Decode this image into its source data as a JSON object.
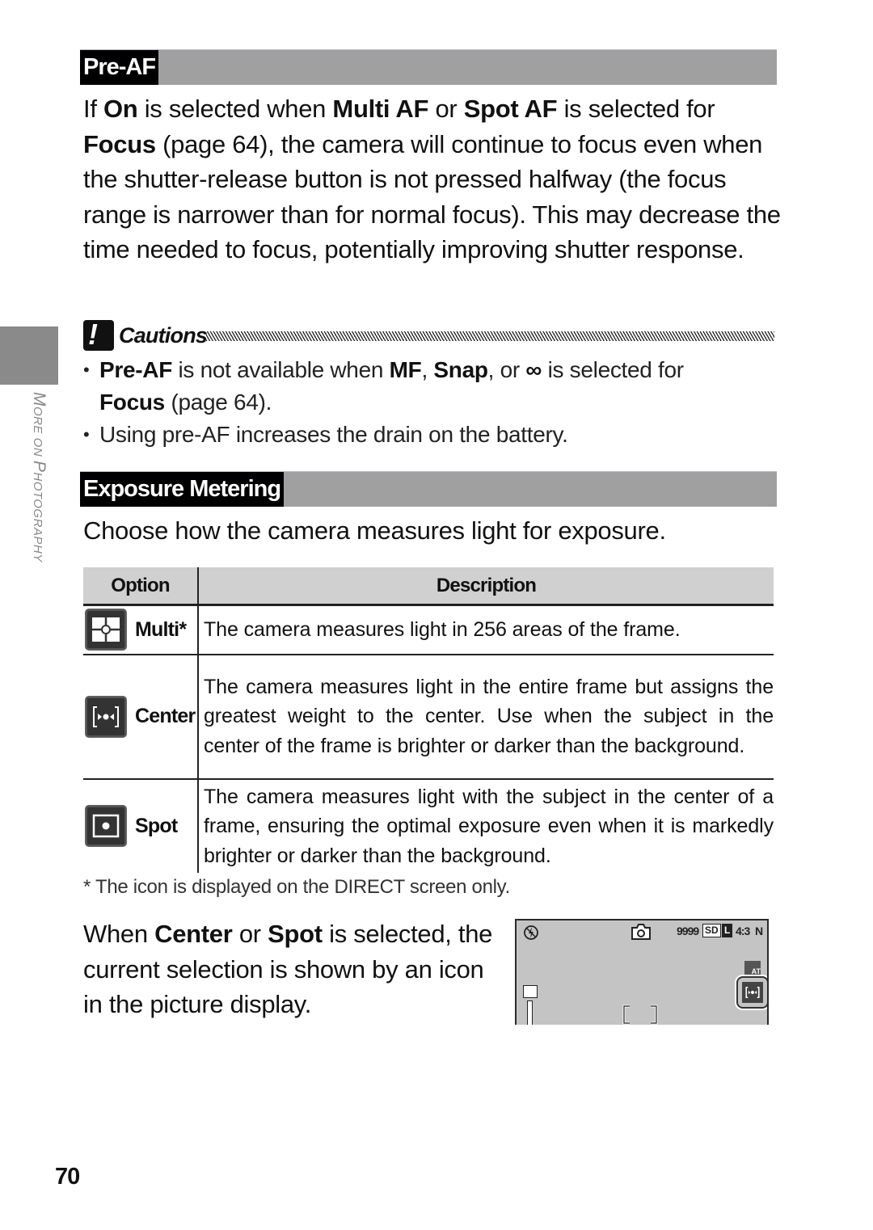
{
  "side_tab": {
    "label_cap1": "M",
    "label_rest1": "ORE ON ",
    "label_cap2": "P",
    "label_rest2": "HOTOGRAPHY"
  },
  "pre_af": {
    "heading": "Pre-AF",
    "paragraph": [
      {
        "t": "If "
      },
      {
        "b": "On"
      },
      {
        "t": " is selected when "
      },
      {
        "b": "Multi AF"
      },
      {
        "t": " or "
      },
      {
        "b": "Spot AF"
      },
      {
        "t": " is selected for "
      },
      {
        "b": "Focus"
      },
      {
        "t": " (page 64), the camera will continue to focus even when the shutter-release button is not pressed halfway (the focus range is narrower than for normal focus). This may decrease the time needed to focus, potentially improving shutter response."
      }
    ]
  },
  "cautions": {
    "icon": "exclamation-icon",
    "icon_glyph": "!",
    "title": "Cautions",
    "items": [
      {
        "b1": "Pre-AF",
        "t1": " is not available when ",
        "b2": "MF",
        "t2": ", ",
        "b3": "Snap",
        "t3": ", or ",
        "sym": "∞",
        "t4": " is selected for ",
        "b4": "Focus",
        "t5": " (page 64)."
      },
      {
        "text": "Using pre-AF increases the drain on the battery."
      }
    ]
  },
  "exposure_metering": {
    "heading": "Exposure Metering",
    "intro": "Choose how the camera measures light for exposure.",
    "table": {
      "headers": {
        "option": "Option",
        "description": "Description"
      },
      "rows": [
        {
          "icon": "multi-metering-icon",
          "option": "Multi*",
          "description": "The camera measures light in 256 areas of the frame."
        },
        {
          "icon": "center-metering-icon",
          "option": "Center",
          "description": "The camera measures light in the entire frame but assigns the greatest weight to the center. Use when the subject in the center of the frame is brighter or darker than the background."
        },
        {
          "icon": "spot-metering-icon",
          "option": "Spot",
          "description": "The camera measures light with the subject in the center of a frame, ensuring the optimal exposure even when it is markedly brighter or darker than the background."
        }
      ]
    },
    "footnote": "*  The icon is displayed on the DIRECT screen only.",
    "note": {
      "t1": "When ",
      "b1": "Center",
      "t2": " or ",
      "b2": "Spot",
      "t3": " is selected, the current selection is shown by an icon in the picture display."
    }
  },
  "picture_display": {
    "flash_icon": "flash-off-icon",
    "mode_icon": "camera-icon",
    "shots_remaining": "9999",
    "storage": "SD",
    "size": "L",
    "aspect": "4:3",
    "quality": "N",
    "wb_label": "AT",
    "af_icon": "af-target-icon",
    "selected_metering_icon": "center-metering-icon"
  },
  "page_number": "70"
}
